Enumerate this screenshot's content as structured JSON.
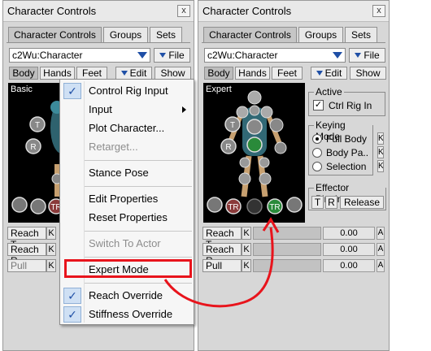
{
  "left_panel": {
    "title": "Character Controls",
    "close": "x",
    "tabs": [
      "Character Controls",
      "Groups",
      "Sets"
    ],
    "character": "c2Wu:Character",
    "file_label": "File",
    "sub_tabs": [
      "Body",
      "Hands",
      "Feet"
    ],
    "edit_label": "Edit",
    "show_label": "Show",
    "view_label": "Basic",
    "rows": [
      {
        "label": "Reach T",
        "k": "K"
      },
      {
        "label": "Reach R",
        "k": "K"
      },
      {
        "label": "Pull",
        "k": "K"
      }
    ]
  },
  "right_panel": {
    "title": "Character Controls",
    "close": "x",
    "tabs": [
      "Character Controls",
      "Groups",
      "Sets"
    ],
    "character": "c2Wu:Character",
    "file_label": "File",
    "sub_tabs": [
      "Body",
      "Hands",
      "Feet"
    ],
    "edit_label": "Edit",
    "show_label": "Show",
    "view_label": "Expert",
    "active_group": {
      "title": "Active",
      "ctrl_rig_in": "Ctrl Rig In",
      "checked": true
    },
    "keying_group": {
      "title": "Keying Mode",
      "options": [
        "Full Body",
        "Body Pa..",
        "Selection"
      ],
      "selected": 0
    },
    "pinning_group": {
      "title": "Effector Pinning",
      "t": "T",
      "r": "R",
      "release": "Release"
    },
    "rows": [
      {
        "label": "Reach T",
        "k": "K",
        "value": "0.00",
        "a": "A"
      },
      {
        "label": "Reach R",
        "k": "K",
        "value": "0.00",
        "a": "A"
      },
      {
        "label": "Pull",
        "k": "K",
        "value": "0.00",
        "a": "A"
      }
    ]
  },
  "tr_label": "TR",
  "t_label": "T",
  "r_label": "R",
  "menu": {
    "items": [
      {
        "label": "Control Rig Input",
        "checked": true
      },
      {
        "label": "Input",
        "submenu": true
      },
      {
        "label": "Plot Character..."
      },
      {
        "label": "Retarget...",
        "disabled": true
      },
      {
        "label": "Stance Pose"
      },
      {
        "label": "Edit Properties"
      },
      {
        "label": "Reset Properties"
      },
      {
        "label": "Switch To Actor",
        "disabled": true
      },
      {
        "label": "Expert Mode"
      },
      {
        "label": "Reach Override",
        "checked": true
      },
      {
        "label": "Stiffness Override",
        "checked": true
      }
    ]
  },
  "colors": {
    "highlight": "#e8141c",
    "check_bg": "#cfe0f4",
    "body_green": "#2a8a3a",
    "body_red": "#b03030"
  }
}
